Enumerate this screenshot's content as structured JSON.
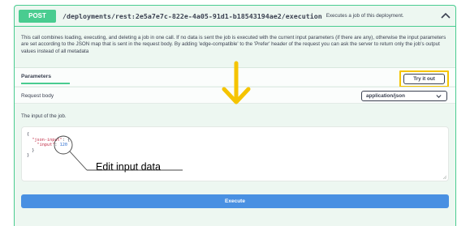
{
  "operation": {
    "method": "POST",
    "path": "/deployments/rest:2e5a7e7c-822e-4a05-91d1-b18543194ae2/execution",
    "summary": "Executes a job of this deployment.",
    "description": "This call combines loading, executing, and deleting a job in one call. If no data is sent the job is executed with the current input parameters (if there are any), otherwise the input parameters are set according to the JSON map that is sent in the request body. By adding 'edge-compatible' to the 'Prefer' header of the request you can ask the server to return only the job's output values instead of all metadata"
  },
  "parameters": {
    "title": "Parameters",
    "try_it_out_label": "Try it out"
  },
  "request_body": {
    "label": "Request body",
    "content_type": "application/json",
    "input_description": "The input of the job.",
    "code_lines": {
      "l1": "{",
      "l2_key": "\"json-input\"",
      "l2_rest": ": {",
      "l3_key": "\"input\"",
      "l3_sep": ": ",
      "l3_val": "120",
      "l4": "}",
      "l5": "}"
    }
  },
  "annotation": {
    "label": "Edit input data"
  },
  "actions": {
    "execute_label": "Execute"
  },
  "colors": {
    "post_green": "#49cc90",
    "highlight_yellow": "#f5c400",
    "execute_blue": "#4990e2"
  }
}
